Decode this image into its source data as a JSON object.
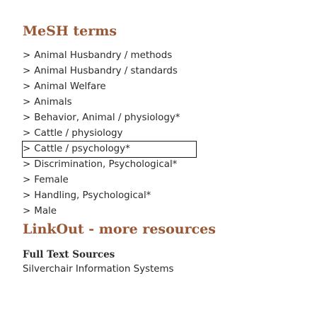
{
  "mesh": {
    "title": "MeSH terms",
    "chevron": ">",
    "terms": [
      {
        "label": "Animal Husbandry / methods",
        "selected": false
      },
      {
        "label": "Animal Husbandry / standards",
        "selected": false
      },
      {
        "label": "Animal Welfare",
        "selected": false
      },
      {
        "label": "Animals",
        "selected": false
      },
      {
        "label": "Behavior, Animal / physiology*",
        "selected": false
      },
      {
        "label": "Cattle / physiology",
        "selected": false
      },
      {
        "label": "Cattle / psychology*",
        "selected": true
      },
      {
        "label": "Discrimination, Psychological*",
        "selected": false
      },
      {
        "label": "Female",
        "selected": false
      },
      {
        "label": "Handling, Psychological*",
        "selected": false
      },
      {
        "label": "Male",
        "selected": false
      }
    ]
  },
  "linkout": {
    "title": "LinkOut - more resources",
    "full_text_heading": "Full Text Sources",
    "sources": [
      {
        "label": "Silverchair Information Systems"
      }
    ]
  },
  "colors": {
    "heading": "#985735",
    "text": "#2a2a2a"
  }
}
